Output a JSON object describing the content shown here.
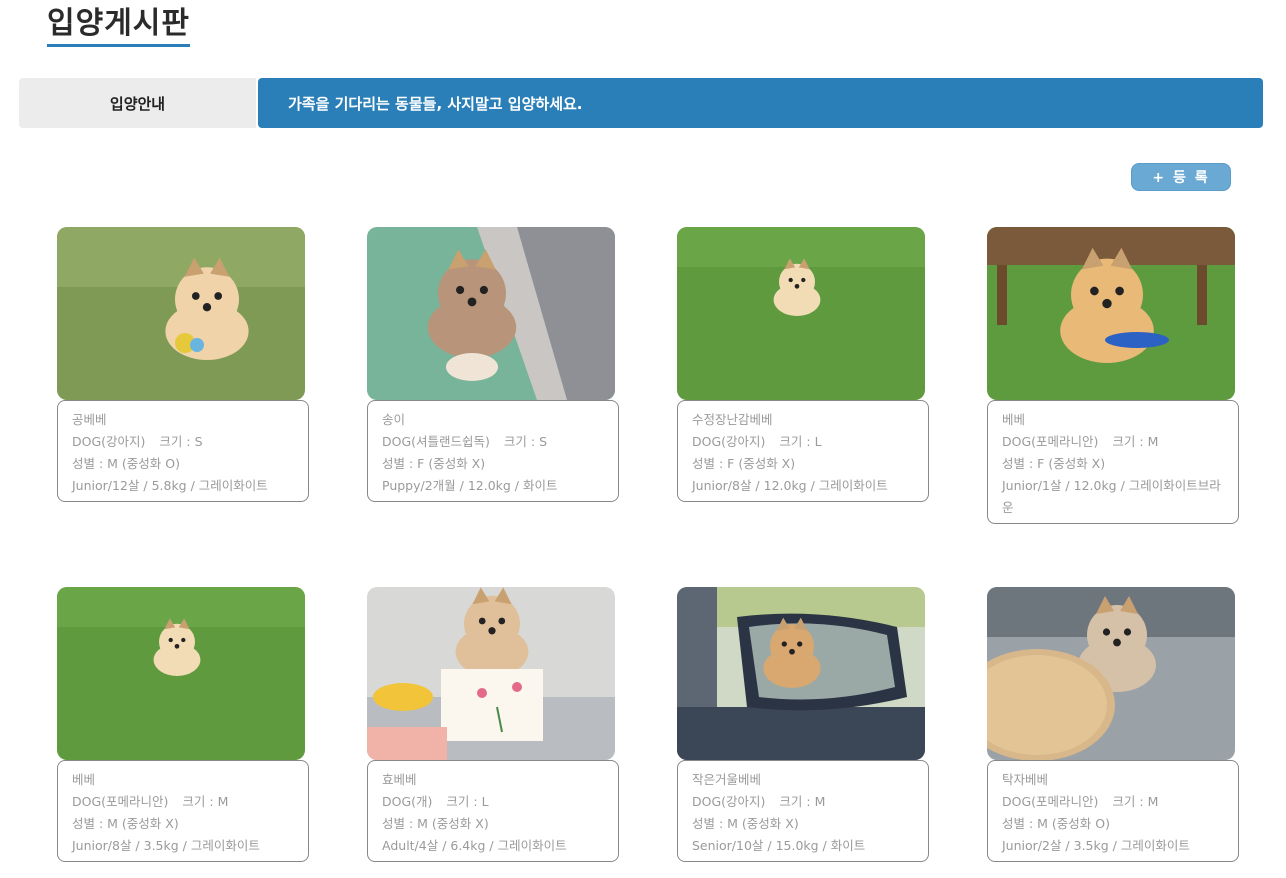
{
  "page": {
    "title": "입양게시판"
  },
  "guide": {
    "tab_label": "입양안내",
    "banner_text": "가족을 기다리는 동물들, 사지말고 입양하세요."
  },
  "toolbar": {
    "register_label": "+ 등 록"
  },
  "pets": [
    {
      "name": "공베베",
      "type": "DOG(강아지)",
      "size": "크기 : S",
      "gender": "성별 : M (중성화 O)",
      "details": "Junior/12살 / 5.8kg / 그레이화이트",
      "photo": "grass-lying"
    },
    {
      "name": "송이",
      "type": "DOG(셔틀랜드쉽독)",
      "size": "크기 : S",
      "gender": "성별 : F (중성화 X)",
      "details": "Puppy/2개월 / 12.0kg / 화이트",
      "photo": "carpet-sitting"
    },
    {
      "name": "수정장난감베베",
      "type": "DOG(강아지)",
      "size": "크기 : L",
      "gender": "성별 : F (중성화 X)",
      "details": "Junior/8살 / 12.0kg / 그레이화이트",
      "photo": "grass-standing"
    },
    {
      "name": "베베",
      "type": "DOG(포메라니안)",
      "size": "크기 : M",
      "gender": "성별 : F (중성화 X)",
      "details": "Junior/1살 / 12.0kg / 그레이화이트브라운",
      "photo": "grass-toy"
    },
    {
      "name": "베베",
      "type": "DOG(포메라니안)",
      "size": "크기 : M",
      "gender": "성별 : M (중성화 X)",
      "details": "Junior/8살 / 3.5kg / 그레이화이트",
      "photo": "grass-standing"
    },
    {
      "name": "효베베",
      "type": "DOG(개)",
      "size": "크기 : L",
      "gender": "성별 : M (중성화 X)",
      "details": "Adult/4살 / 6.4kg / 그레이화이트",
      "photo": "card"
    },
    {
      "name": "작은거울베베",
      "type": "DOG(강아지)",
      "size": "크기 : M",
      "gender": "성별 : M (중성화 X)",
      "details": "Senior/10살 / 15.0kg / 화이트",
      "photo": "mirror"
    },
    {
      "name": "탁자베베",
      "type": "DOG(포메라니안)",
      "size": "크기 : M",
      "gender": "성별 : M (중성화 O)",
      "details": "Junior/2살 / 3.5kg / 그레이화이트",
      "photo": "table"
    }
  ],
  "colors": {
    "accent": "#2a7fb8",
    "tab_bg": "#ececec",
    "register_btn": "#6aa9d3",
    "meta_text": "#9a9a9a"
  }
}
